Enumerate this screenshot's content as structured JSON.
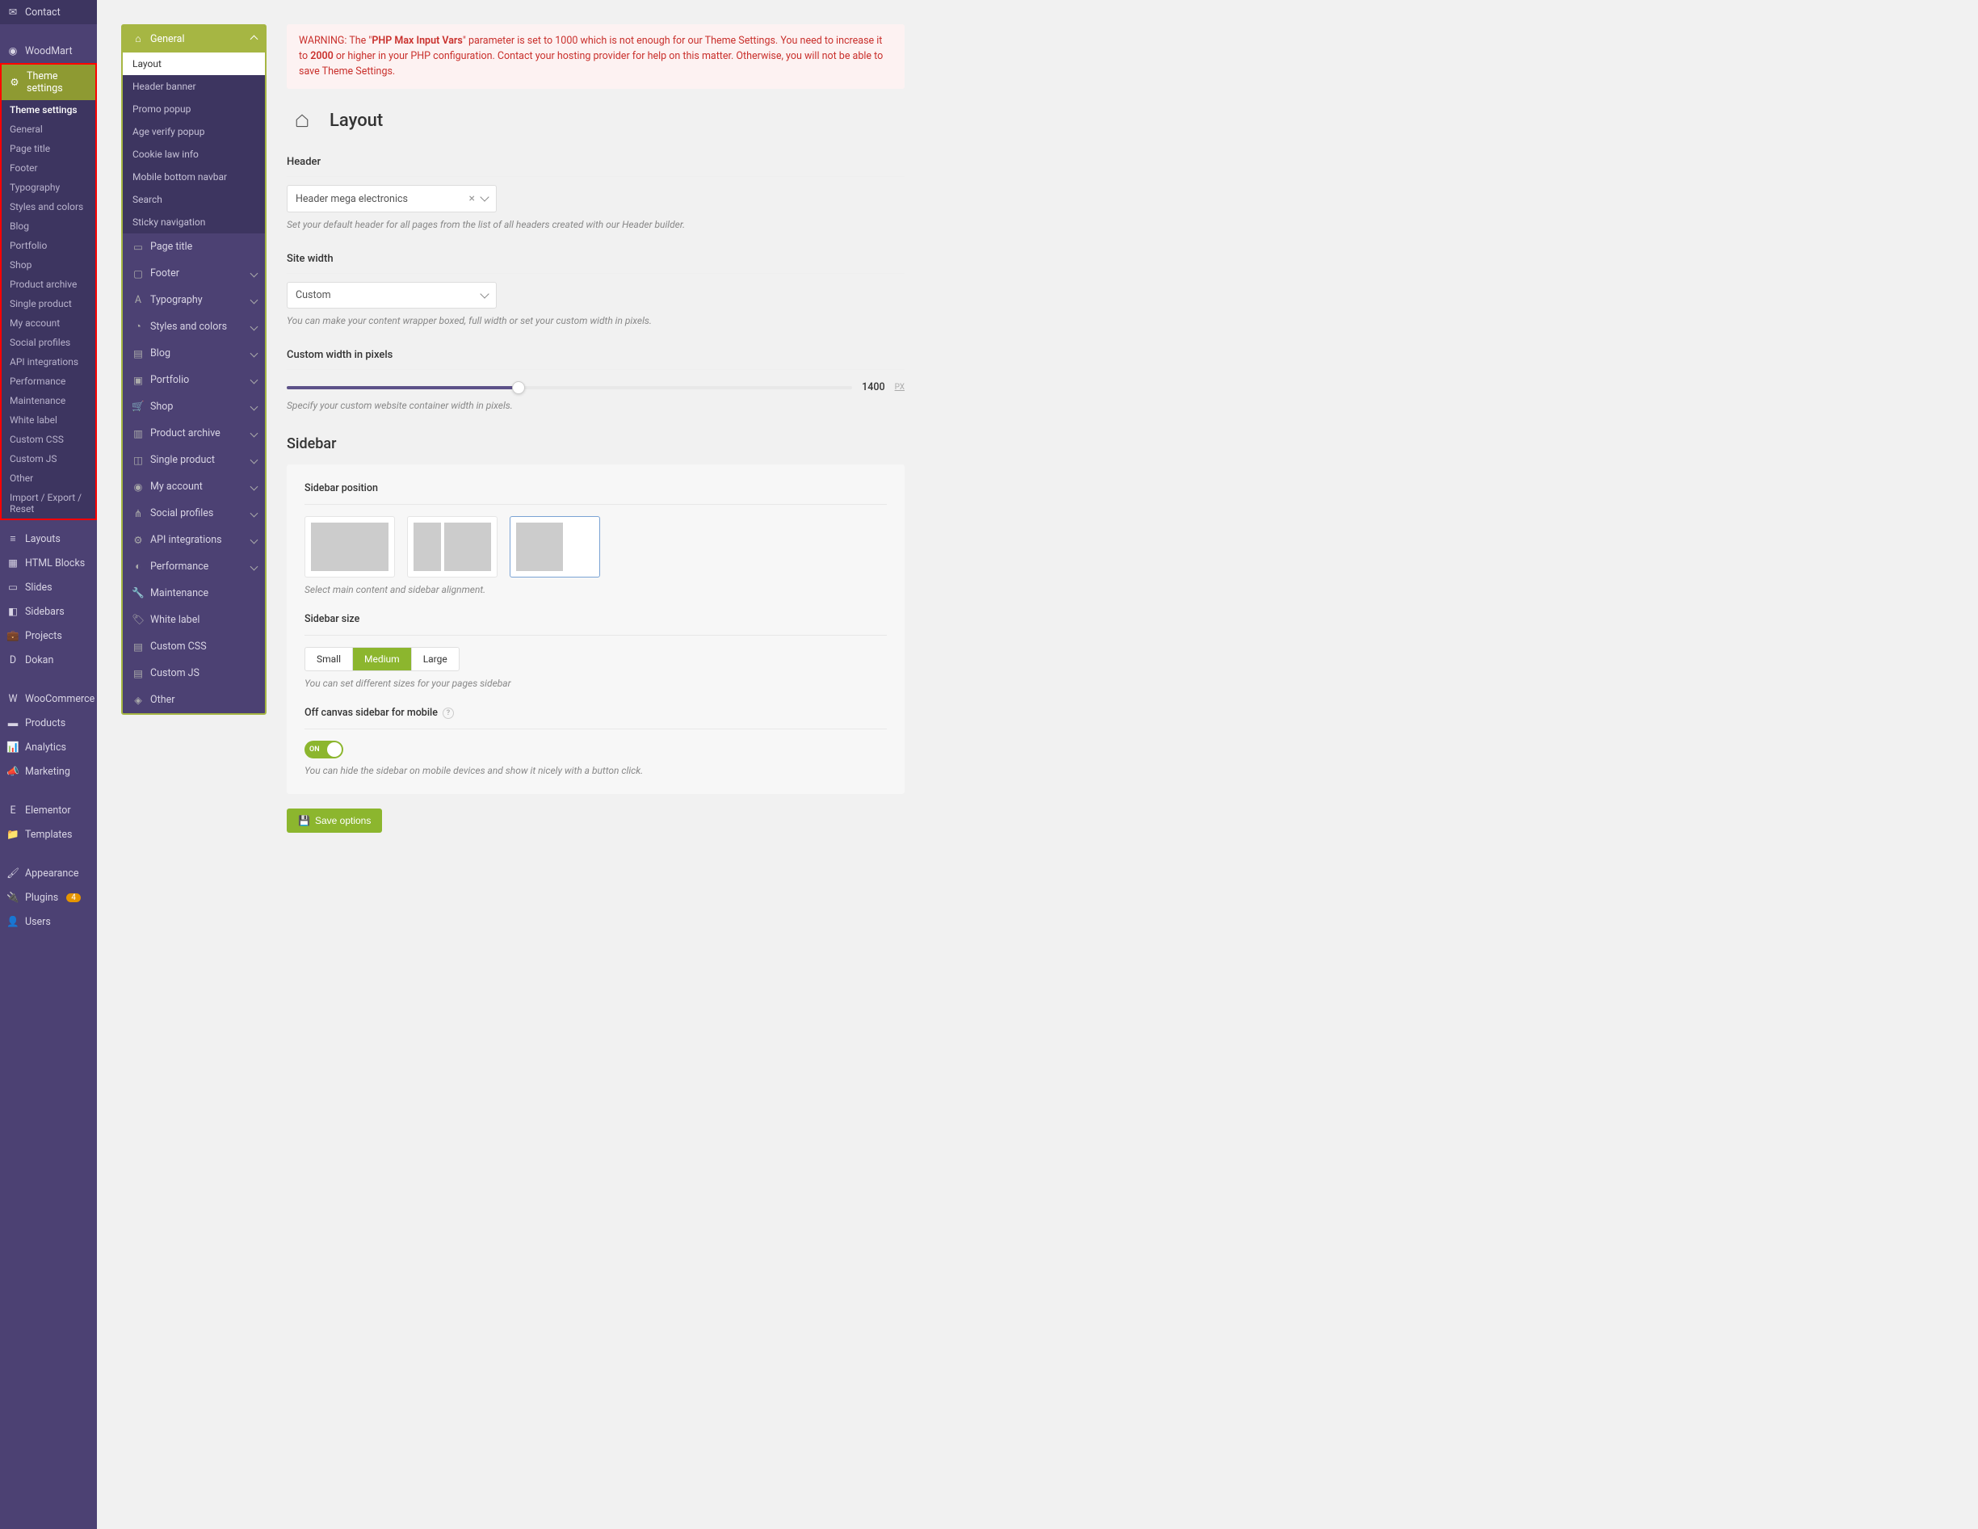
{
  "wp_sidebar": {
    "contact": "Contact",
    "woodmart": "WoodMart",
    "theme_settings": "Theme settings",
    "sub": {
      "theme_settings": "Theme settings",
      "general": "General",
      "page_title": "Page title",
      "footer": "Footer",
      "typography": "Typography",
      "styles_colors": "Styles and colors",
      "blog": "Blog",
      "portfolio": "Portfolio",
      "shop": "Shop",
      "product_archive": "Product archive",
      "single_product": "Single product",
      "my_account": "My account",
      "social_profiles": "Social profiles",
      "api_integrations": "API integrations",
      "performance": "Performance",
      "maintenance": "Maintenance",
      "white_label": "White label",
      "custom_css": "Custom CSS",
      "custom_js": "Custom JS",
      "other": "Other",
      "import_export": "Import / Export / Reset"
    },
    "layouts": "Layouts",
    "html_blocks": "HTML Blocks",
    "slides": "Slides",
    "sidebars": "Sidebars",
    "projects": "Projects",
    "dokan": "Dokan",
    "woocommerce": "WooCommerce",
    "products": "Products",
    "analytics": "Analytics",
    "marketing": "Marketing",
    "elementor": "Elementor",
    "templates": "Templates",
    "appearance": "Appearance",
    "plugins": "Plugins",
    "plugins_badge": "4",
    "users": "Users"
  },
  "settings_sidebar": {
    "general": "General",
    "general_sub": {
      "layout": "Layout",
      "header_banner": "Header banner",
      "promo_popup": "Promo popup",
      "age_verify": "Age verify popup",
      "cookie_law": "Cookie law info",
      "mobile_navbar": "Mobile bottom navbar",
      "search": "Search",
      "sticky_nav": "Sticky navigation"
    },
    "page_title": "Page title",
    "footer": "Footer",
    "typography": "Typography",
    "styles_colors": "Styles and colors",
    "blog": "Blog",
    "portfolio": "Portfolio",
    "shop": "Shop",
    "product_archive": "Product archive",
    "single_product": "Single product",
    "my_account": "My account",
    "social_profiles": "Social profiles",
    "api_integrations": "API integrations",
    "performance": "Performance",
    "maintenance": "Maintenance",
    "white_label": "White label",
    "custom_css": "Custom CSS",
    "custom_js": "Custom JS",
    "other": "Other"
  },
  "warning": {
    "prefix": "WARNING: The \"",
    "param": "PHP Max Input Vars",
    "mid1": "\" parameter is set to 1000 which is not enough for our Theme Settings. You need to increase it to ",
    "value": "2000",
    "mid2": " or higher in your PHP configuration. Contact your hosting provider for help on this matter. Otherwise, you will not be able to save Theme Settings."
  },
  "page": {
    "title": "Layout"
  },
  "header": {
    "label": "Header",
    "value": "Header mega electronics",
    "hint": "Set your default header for all pages from the list of all headers created with our Header builder."
  },
  "site_width": {
    "label": "Site width",
    "value": "Custom",
    "hint": "You can make your content wrapper boxed, full width or set your custom width in pixels."
  },
  "custom_width": {
    "label": "Custom width in pixels",
    "value": "1400",
    "unit": "PX",
    "hint": "Specify your custom website container width in pixels."
  },
  "sidebar": {
    "title": "Sidebar",
    "position": {
      "label": "Sidebar position",
      "hint": "Select main content and sidebar alignment."
    },
    "size": {
      "label": "Sidebar size",
      "small": "Small",
      "medium": "Medium",
      "large": "Large",
      "hint": "You can set different sizes for your pages sidebar"
    },
    "offcanvas": {
      "label": "Off canvas sidebar for mobile",
      "toggle": "ON",
      "hint": "You can hide the sidebar on mobile devices and show it nicely with a button click."
    }
  },
  "save": "Save options"
}
